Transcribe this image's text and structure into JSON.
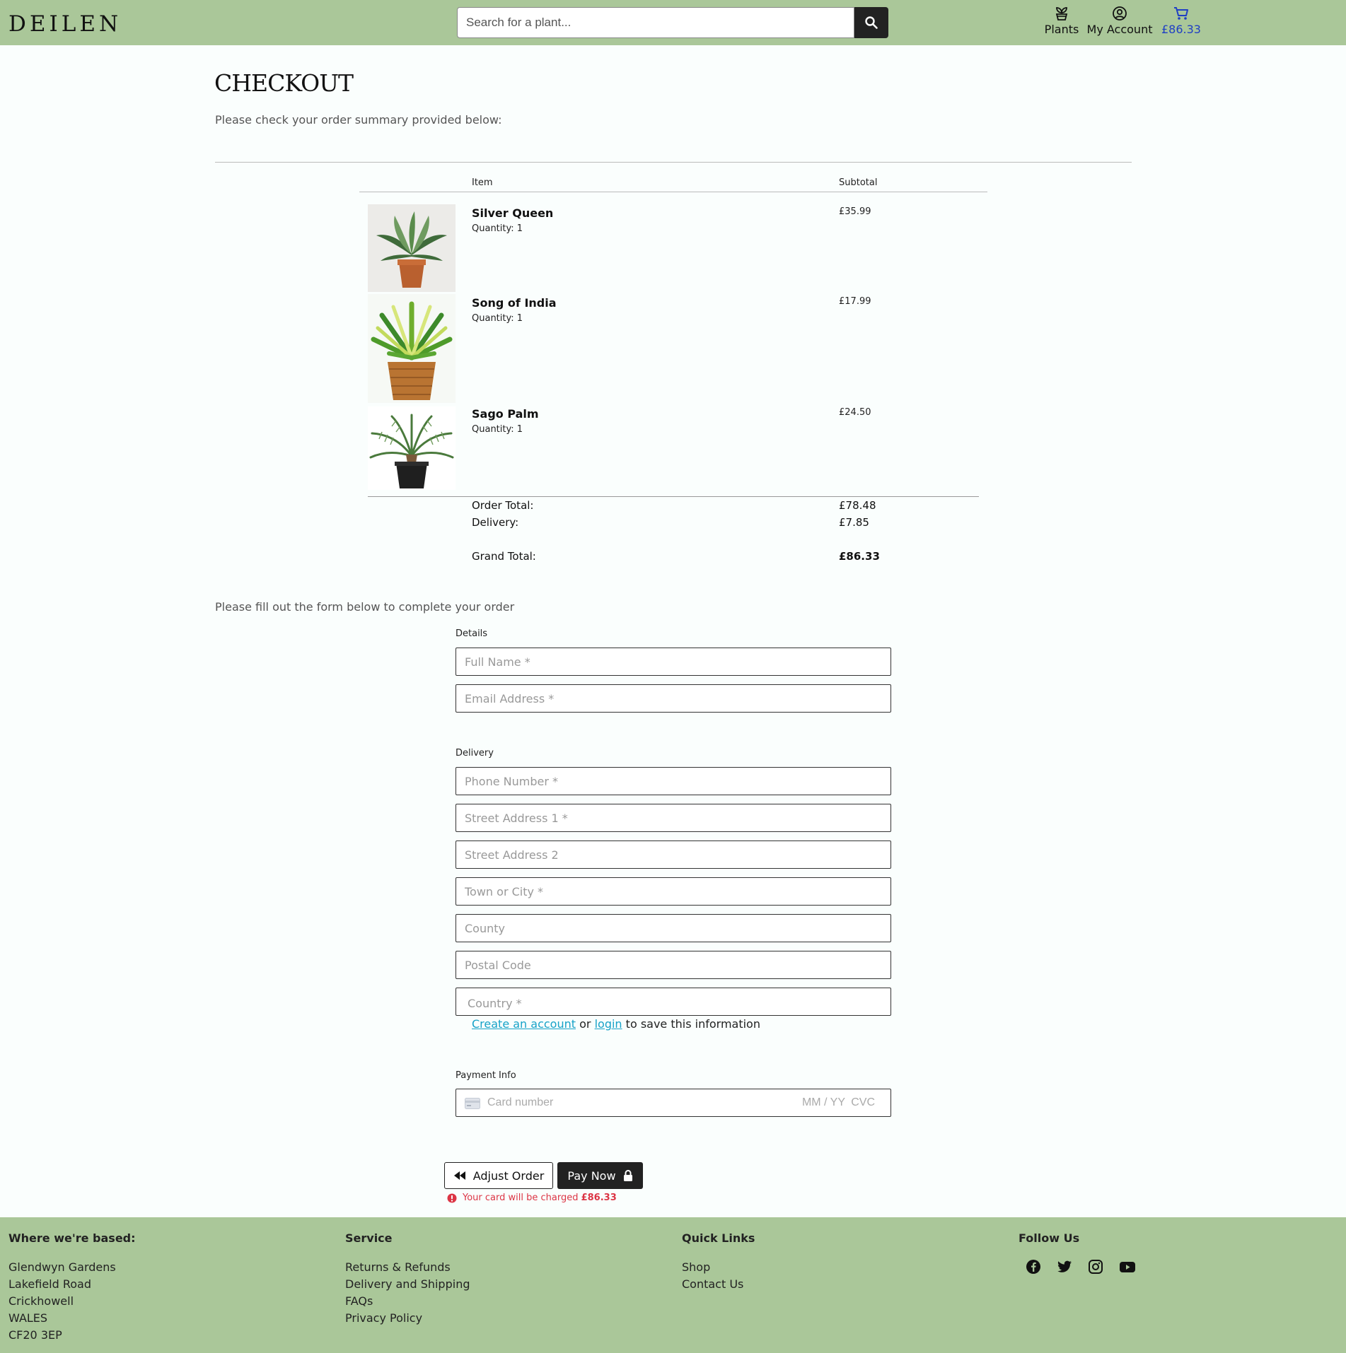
{
  "header": {
    "logo": "DEILEN",
    "search_placeholder": "Search for a plant...",
    "nav": {
      "plants": "Plants",
      "account": "My Account",
      "cart": "£86.33"
    }
  },
  "checkout": {
    "title": "CHECKOUT",
    "intro": "Please check your order summary provided below:",
    "col_item": "Item",
    "col_subtotal": "Subtotal",
    "items": [
      {
        "name": "Silver Queen",
        "quantity": "Quantity: 1",
        "subtotal": "£35.99"
      },
      {
        "name": "Song of India",
        "quantity": "Quantity: 1",
        "subtotal": "£17.99"
      },
      {
        "name": "Sago Palm",
        "quantity": "Quantity: 1",
        "subtotal": "£24.50"
      }
    ],
    "order_total_label": "Order Total:",
    "order_total": "£78.48",
    "delivery_label": "Delivery:",
    "delivery": "£7.85",
    "grand_total_label": "Grand Total:",
    "grand_total": "£86.33"
  },
  "form": {
    "intro": "Please fill out the form below to complete your order",
    "details_label": "Details",
    "full_name_ph": "Full Name *",
    "email_ph": "Email Address *",
    "delivery_label": "Delivery",
    "phone_ph": "Phone Number *",
    "street1_ph": "Street Address 1 *",
    "street2_ph": "Street Address 2",
    "town_ph": "Town or City *",
    "county_ph": "County",
    "postal_ph": "Postal Code",
    "country_ph": "Country *",
    "create_account": "Create an account",
    "or": "or",
    "login": "login",
    "save_suffix": "to save this information",
    "payment_label": "Payment Info",
    "card_number_ph": "Card number",
    "card_exp_ph": "MM / YY",
    "card_cvc_ph": "CVC",
    "adjust_button": "Adjust Order",
    "pay_button": "Pay Now",
    "charge_note": "Your card will be charged",
    "charge_amount": "£86.33"
  },
  "footer": {
    "based_title": "Where we're based:",
    "address": [
      "Glendwyn Gardens",
      "Lakefield Road",
      "Crickhowell",
      "WALES",
      "CF20 3EP"
    ],
    "service_title": "Service",
    "service_links": [
      "Returns & Refunds",
      "Delivery and Shipping",
      "FAQs",
      "Privacy Policy"
    ],
    "quick_title": "Quick Links",
    "quick_links": [
      "Shop",
      "Contact Us"
    ],
    "follow_title": "Follow Us",
    "social_icons": [
      "facebook-icon",
      "twitter-icon",
      "instagram-icon",
      "youtube-icon"
    ]
  },
  "colors": {
    "header_bg": "#aac799",
    "link": "#17a2c8",
    "cart": "#1f3fc4",
    "alert": "#dc3545",
    "dark": "#222222"
  }
}
